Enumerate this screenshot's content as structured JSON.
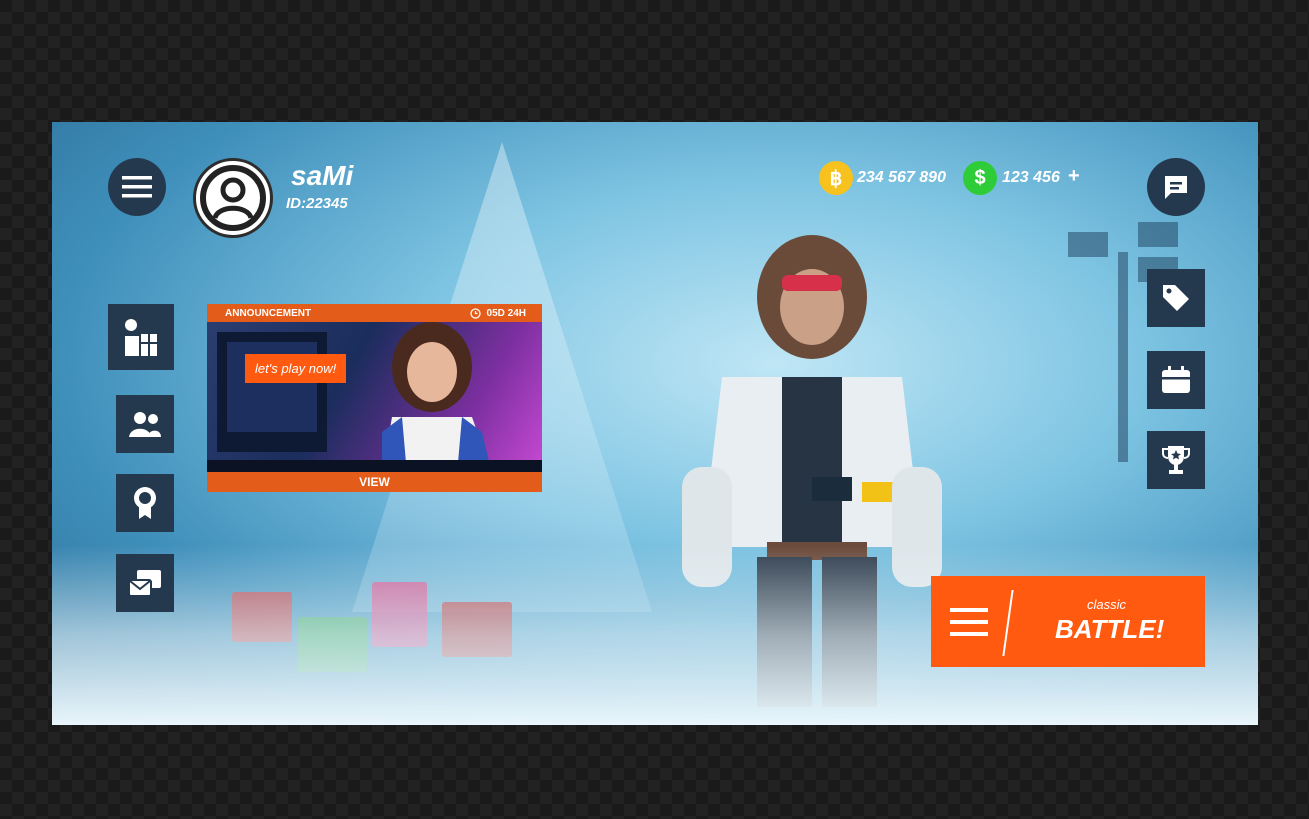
{
  "player": {
    "name": "saMi",
    "id": "ID:22345"
  },
  "currency": {
    "coins": {
      "icon": "bitcoin-icon",
      "color": "#f7c21d",
      "amount": "234 567 890"
    },
    "cash": {
      "icon": "dollar-icon",
      "color": "#2fcc3a",
      "amount": "123 456",
      "add_label": "+"
    }
  },
  "announcement": {
    "title": "ANNOUNCEMENT",
    "timer": "05D 24H",
    "cta": "let's play now!",
    "view_label": "VIEW"
  },
  "battle": {
    "mode": "classic",
    "label": "BATTLE!"
  },
  "left_menu": [
    "gifts-icon",
    "friends-icon",
    "achievements-icon",
    "mail-icon"
  ],
  "right_menu": [
    "chat-icon",
    "tag-icon",
    "calendar-icon",
    "trophy-icon"
  ],
  "colors": {
    "accent": "#ff5a10",
    "button_bg": "#24394d"
  }
}
